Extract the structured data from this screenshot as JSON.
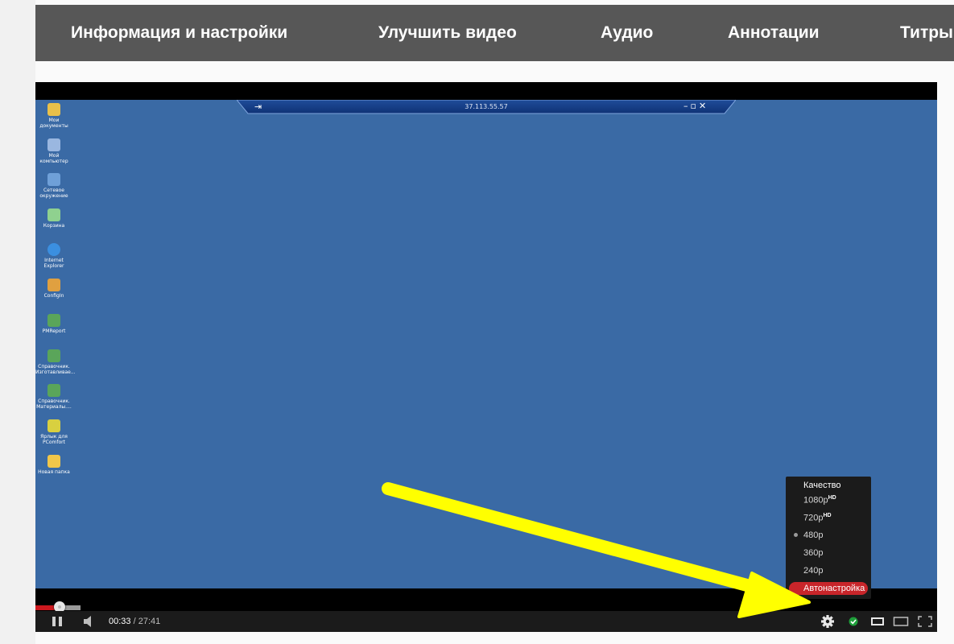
{
  "tabs": [
    {
      "label": "Информация и настройки"
    },
    {
      "label": "Улучшить видео"
    },
    {
      "label": "Аудио"
    },
    {
      "label": "Аннотации"
    },
    {
      "label": "Титры"
    }
  ],
  "video": {
    "rdp_title": "37.113.55.57",
    "desktop_icons": [
      {
        "label": "Мои\nдокументы",
        "icon": "folder-documents-icon",
        "color": "#e8c04a"
      },
      {
        "label": "Мой\nкомпьютер",
        "icon": "my-computer-icon",
        "color": "#9ab7e0"
      },
      {
        "label": "Сетевое\nокружение",
        "icon": "network-icon",
        "color": "#6fa0d8"
      },
      {
        "label": "Корзина",
        "icon": "recycle-bin-icon",
        "color": "#8fd18f"
      },
      {
        "label": "Internet\nExplorer",
        "icon": "internet-explorer-icon",
        "color": "#3b8fe0"
      },
      {
        "label": "ConfigIn",
        "icon": "config-icon",
        "color": "#e0a040"
      },
      {
        "label": "PMReport",
        "icon": "report-icon",
        "color": "#5aa55a"
      },
      {
        "label": "Справочник.\nИзготавливае...",
        "icon": "excel-file-icon",
        "color": "#5aa55a"
      },
      {
        "label": "Справочник.\nМатериалы....",
        "icon": "excel-file-icon",
        "color": "#5aa55a"
      },
      {
        "label": "Ярлык для\nPComfort",
        "icon": "shortcut-icon",
        "color": "#d8d040"
      },
      {
        "label": "Новая папка",
        "icon": "folder-icon",
        "color": "#f0c64a"
      }
    ]
  },
  "player": {
    "progress_fraction": 0.02,
    "time_current": "00:33",
    "time_separator": " / ",
    "time_total": "27:41"
  },
  "quality_menu": {
    "title": "Качество",
    "options": [
      {
        "label": "1080p",
        "badge": "HD"
      },
      {
        "label": "720p",
        "badge": "HD"
      },
      {
        "label": "480p",
        "badge": "",
        "selected": true
      },
      {
        "label": "360p",
        "badge": ""
      },
      {
        "label": "240p",
        "badge": ""
      }
    ],
    "auto_label": "Автонастройка"
  },
  "colors": {
    "tabbar_bg": "#575757",
    "video_bg": "#3a6aa5",
    "accent_red": "#cc181e",
    "arrow_yellow": "#ffff00"
  }
}
